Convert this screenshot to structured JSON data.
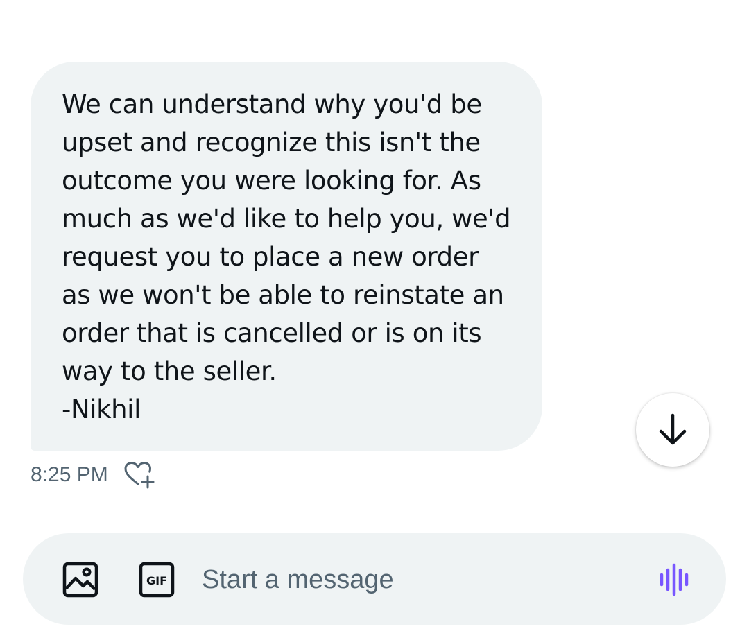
{
  "message": {
    "lines": [
      "We can understand why you'd be",
      "upset and recognize this isn't the",
      "outcome you were looking for. As",
      "much as we'd like to help you, we'd",
      "request you to place a new order",
      "as we won't be able to reinstate an",
      "order that is cancelled or is on its",
      "way to the seller.",
      "-Nikhil"
    ],
    "timestamp": "8:25 PM",
    "react_icon": "heart-plus-icon"
  },
  "scroll_button": {
    "icon": "arrow-down-icon"
  },
  "composer": {
    "placeholder": "Start a message",
    "media_icon": "image-icon",
    "gif_label": "GIF",
    "voice_icon": "voice-waveform-icon"
  },
  "colors": {
    "bubble_bg": "#eff3f4",
    "text": "#0f1419",
    "secondary_text": "#536471",
    "voice_accent": "#7856ff"
  }
}
